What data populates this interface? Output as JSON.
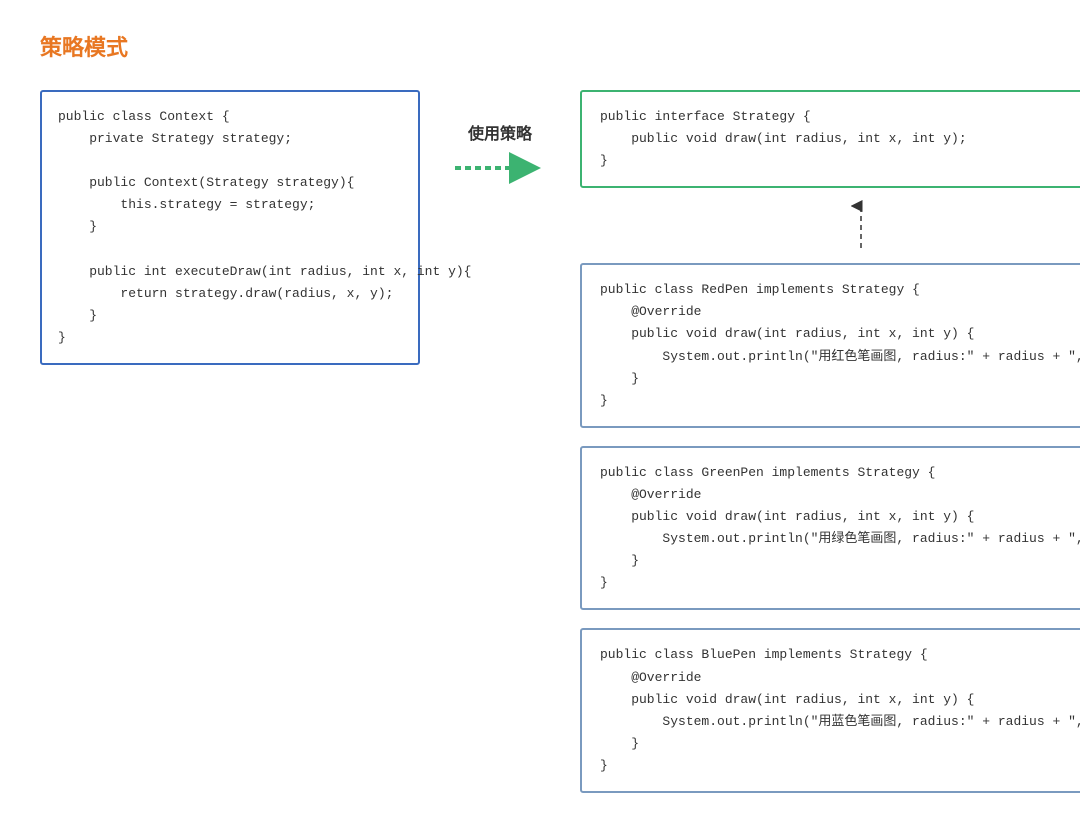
{
  "title": "策略模式",
  "use_strategy_label": "使用策略",
  "context_code": "public class Context {\n    private Strategy strategy;\n\n    public Context(Strategy strategy){\n        this.strategy = strategy;\n    }\n\n    public int executeDraw(int radius, int x, int y){\n        return strategy.draw(radius, x, y);\n    }\n}",
  "interface_code": "public interface Strategy {\n    public void draw(int radius, int x, int y);\n}",
  "redpen_code": "public class RedPen implements Strategy {\n    @Override\n    public void draw(int radius, int x, int y) {\n        System.out.println(\"用红色笔画图, radius:\" + radius + \", x:\"…\n    }\n}",
  "greenpen_code": "public class GreenPen implements Strategy {\n    @Override\n    public void draw(int radius, int x, int y) {\n        System.out.println(\"用绿色笔画图, radius:\" + radius + \", x:\"…\n    }\n}",
  "bluepen_code": "public class BluePen implements Strategy {\n    @Override\n    public void draw(int radius, int x, int y) {\n        System.out.println(\"用蓝色笔画图, radius:\" + radius + \", x:\"…\n    }\n}"
}
